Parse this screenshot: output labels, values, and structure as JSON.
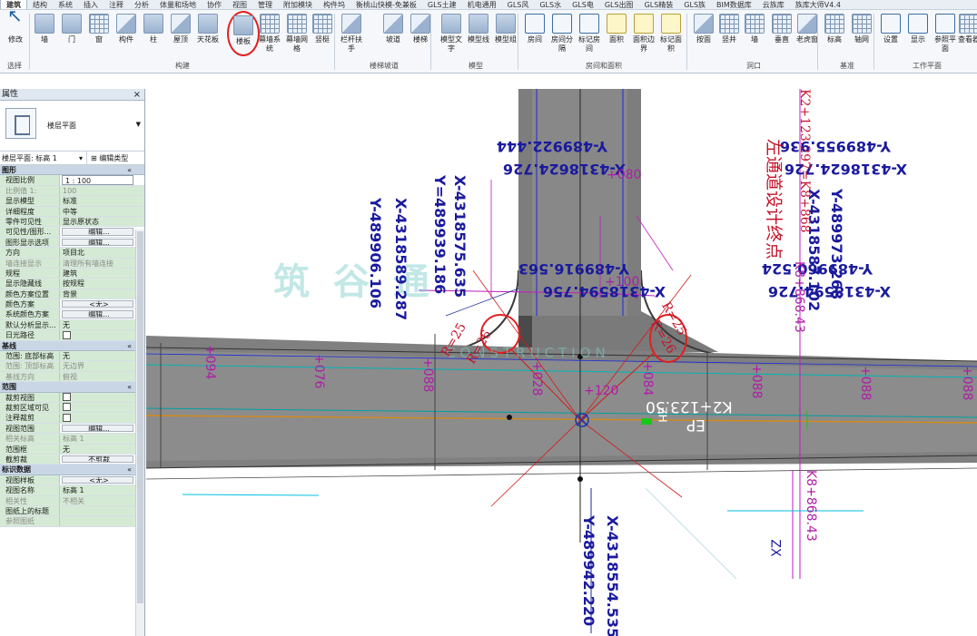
{
  "menu": {
    "tabs": [
      "建筑",
      "结构",
      "系统",
      "插入",
      "注释",
      "分析",
      "体量和场地",
      "协作",
      "视图",
      "管理",
      "附加模块",
      "构件坞",
      "衡桃山快模-免兼板",
      "GLS土建",
      "机电通用",
      "GLS风",
      "GLS水",
      "GLS电",
      "GLS出图",
      "GLS精装",
      "GLS族",
      "BIM数据库",
      "云族库",
      "族库大师V4.4"
    ]
  },
  "ribbon": {
    "buttons": [
      {
        "label": "修改",
        "icon": "modify-cursor-icon"
      },
      {
        "label": "墙",
        "icon": "wall-icon"
      },
      {
        "label": "门",
        "icon": "door-icon"
      },
      {
        "label": "窗",
        "icon": "window-icon"
      },
      {
        "label": "构件",
        "icon": "component-icon"
      },
      {
        "label": "柱",
        "icon": "column-icon"
      },
      {
        "label": "屋顶",
        "icon": "roof-icon"
      },
      {
        "label": "天花板",
        "icon": "ceiling-icon"
      },
      {
        "label": "楼板",
        "icon": "floor-icon"
      },
      {
        "label": "幕墙系统",
        "icon": "curtain-system-icon"
      },
      {
        "label": "幕墙网格",
        "icon": "curtain-grid-icon"
      },
      {
        "label": "竖梃",
        "icon": "mullion-icon"
      },
      {
        "label": "栏杆扶手",
        "icon": "railing-icon"
      },
      {
        "label": "坡道",
        "icon": "ramp-icon"
      },
      {
        "label": "楼梯",
        "icon": "stair-icon"
      },
      {
        "label": "模型文字",
        "icon": "model-text-icon"
      },
      {
        "label": "模型线",
        "icon": "model-line-icon"
      },
      {
        "label": "模型组",
        "icon": "model-group-icon"
      },
      {
        "label": "房间",
        "icon": "room-icon"
      },
      {
        "label": "房间分隔",
        "icon": "room-separator-icon"
      },
      {
        "label": "标记房间",
        "icon": "tag-room-icon"
      },
      {
        "label": "面积",
        "icon": "area-icon"
      },
      {
        "label": "面积边界",
        "icon": "area-boundary-icon"
      },
      {
        "label": "标记面积",
        "icon": "tag-area-icon"
      },
      {
        "label": "按面",
        "icon": "by-face-icon"
      },
      {
        "label": "竖井",
        "icon": "shaft-icon"
      },
      {
        "label": "墙",
        "icon": "wall-opening-icon"
      },
      {
        "label": "垂直",
        "icon": "vertical-opening-icon"
      },
      {
        "label": "老虎窗",
        "icon": "dormer-icon"
      },
      {
        "label": "标高",
        "icon": "level-icon"
      },
      {
        "label": "轴网",
        "icon": "grid-icon"
      },
      {
        "label": "设置",
        "icon": "settings-icon"
      },
      {
        "label": "显示",
        "icon": "show-icon"
      },
      {
        "label": "参照平面",
        "icon": "reference-plane-icon"
      },
      {
        "label": "查看器",
        "icon": "viewer-icon"
      }
    ],
    "groups": [
      "选择",
      "构建",
      "楼梯坡道",
      "模型",
      "房间和面积",
      "洞口",
      "基准",
      "工作平面"
    ]
  },
  "properties": {
    "title": "属性",
    "type_name": "楼层平面",
    "instance_selector": "楼层平面: 标高 1",
    "edit_type_label": "编辑类型",
    "sections": [
      {
        "name": "图形",
        "rows": [
          {
            "name": "视图比例",
            "value": "1 : 100",
            "kind": "input"
          },
          {
            "name": "比例值 1:",
            "value": "100",
            "kind": "ro"
          },
          {
            "name": "显示模型",
            "value": "标准",
            "kind": "text"
          },
          {
            "name": "详细程度",
            "value": "中等",
            "kind": "text"
          },
          {
            "name": "零件可见性",
            "value": "显示原状态",
            "kind": "text"
          },
          {
            "name": "可见性/图形...",
            "value": "编辑...",
            "kind": "btn"
          },
          {
            "name": "图形显示选项",
            "value": "编辑...",
            "kind": "btn"
          },
          {
            "name": "方向",
            "value": "项目北",
            "kind": "text"
          },
          {
            "name": "墙连接显示",
            "value": "清理所有墙连接",
            "kind": "ro"
          },
          {
            "name": "规程",
            "value": "建筑",
            "kind": "text"
          },
          {
            "name": "显示隐藏线",
            "value": "按规程",
            "kind": "text"
          },
          {
            "name": "颜色方案位置",
            "value": "背景",
            "kind": "text"
          },
          {
            "name": "颜色方案",
            "value": "<无>",
            "kind": "btn"
          },
          {
            "name": "系统颜色方案",
            "value": "编辑...",
            "kind": "btn"
          },
          {
            "name": "默认分析显示...",
            "value": "无",
            "kind": "text"
          },
          {
            "name": "日光路径",
            "value": "",
            "kind": "check"
          }
        ]
      },
      {
        "name": "基线",
        "rows": [
          {
            "name": "范围: 底部标高",
            "value": "无",
            "kind": "text"
          },
          {
            "name": "范围: 顶部标高",
            "value": "无边界",
            "kind": "ro"
          },
          {
            "name": "基线方向",
            "value": "俯视",
            "kind": "ro"
          }
        ]
      },
      {
        "name": "范围",
        "rows": [
          {
            "name": "裁剪视图",
            "value": "",
            "kind": "check"
          },
          {
            "name": "裁剪区域可见",
            "value": "",
            "kind": "check"
          },
          {
            "name": "注释裁剪",
            "value": "",
            "kind": "check"
          },
          {
            "name": "视图范围",
            "value": "编辑...",
            "kind": "btn"
          },
          {
            "name": "相关标高",
            "value": "标高 1",
            "kind": "ro"
          },
          {
            "name": "范围框",
            "value": "无",
            "kind": "text"
          },
          {
            "name": "截剪裁",
            "value": "不剪裁",
            "kind": "btn"
          }
        ]
      },
      {
        "name": "标识数据",
        "rows": [
          {
            "name": "视图样板",
            "value": "<无>",
            "kind": "btn"
          },
          {
            "name": "视图名称",
            "value": "标高 1",
            "kind": "text"
          },
          {
            "name": "相关性",
            "value": "不相关",
            "kind": "ro"
          },
          {
            "name": "图纸上的标题",
            "value": "",
            "kind": "text"
          },
          {
            "name": "参照图纸",
            "value": "",
            "kind": "ro"
          }
        ]
      }
    ]
  },
  "canvas": {
    "coords": [
      {
        "text": "Y-489922.444",
        "rot": 180
      },
      {
        "text": "X-4318624.726",
        "rot": 180
      },
      {
        "text": "Y-489955.936",
        "rot": 180
      },
      {
        "text": "X-4318624.726",
        "rot": 180
      },
      {
        "text": "X-4318575.635",
        "rot": 90
      },
      {
        "text": "Y=489939.186",
        "rot": 90
      },
      {
        "text": "X-4318589.287",
        "rot": 90
      },
      {
        "text": "Y-489906.106",
        "rot": 90
      },
      {
        "text": "Y-489916.563",
        "rot": 180
      },
      {
        "text": "X-4318594.756",
        "rot": 180
      },
      {
        "text": "Y-489960.524",
        "rot": 180
      },
      {
        "text": "X-4318594.726",
        "rot": 180
      },
      {
        "text": "Y-489973.268",
        "rot": 90
      },
      {
        "text": "X-4318587.102",
        "rot": 90
      },
      {
        "text": "X-4318554.535",
        "rot": 90
      },
      {
        "text": "Y-489942.220",
        "rot": 90
      }
    ],
    "elevations": [
      {
        "text": "+080",
        "rot": 0
      },
      {
        "text": "+100",
        "rot": 0
      },
      {
        "text": "+120",
        "rot": 0
      },
      {
        "text": "+094",
        "rot": 90
      },
      {
        "text": "+076",
        "rot": 90
      },
      {
        "text": "+088",
        "rot": 90
      },
      {
        "text": "+028",
        "rot": 90
      },
      {
        "text": "+084",
        "rot": 90
      },
      {
        "text": "+088",
        "rot": 90
      },
      {
        "text": "+088",
        "rot": 90
      },
      {
        "text": "+088",
        "rot": 90
      },
      {
        "text": "K8+868.43",
        "rot": 90
      },
      {
        "text": "K8+868.43",
        "rot": 90
      }
    ],
    "red_labels": [
      {
        "text": "R=25",
        "rot": -60
      },
      {
        "text": "R=26",
        "rot": -60
      },
      {
        "text": "R=25",
        "rot": 60
      },
      {
        "text": "R=26",
        "rot": 60
      },
      {
        "text": "K2+123.297=K8+868",
        "rot": 90
      },
      {
        "text": "左通道设计终点",
        "rot": 90
      }
    ],
    "white_labels": [
      "K2+123.50",
      "EP",
      "ZH",
      "ZX"
    ],
    "watermark": "筑 谷 通",
    "watermark_sub": "CONSTRUCTION"
  }
}
